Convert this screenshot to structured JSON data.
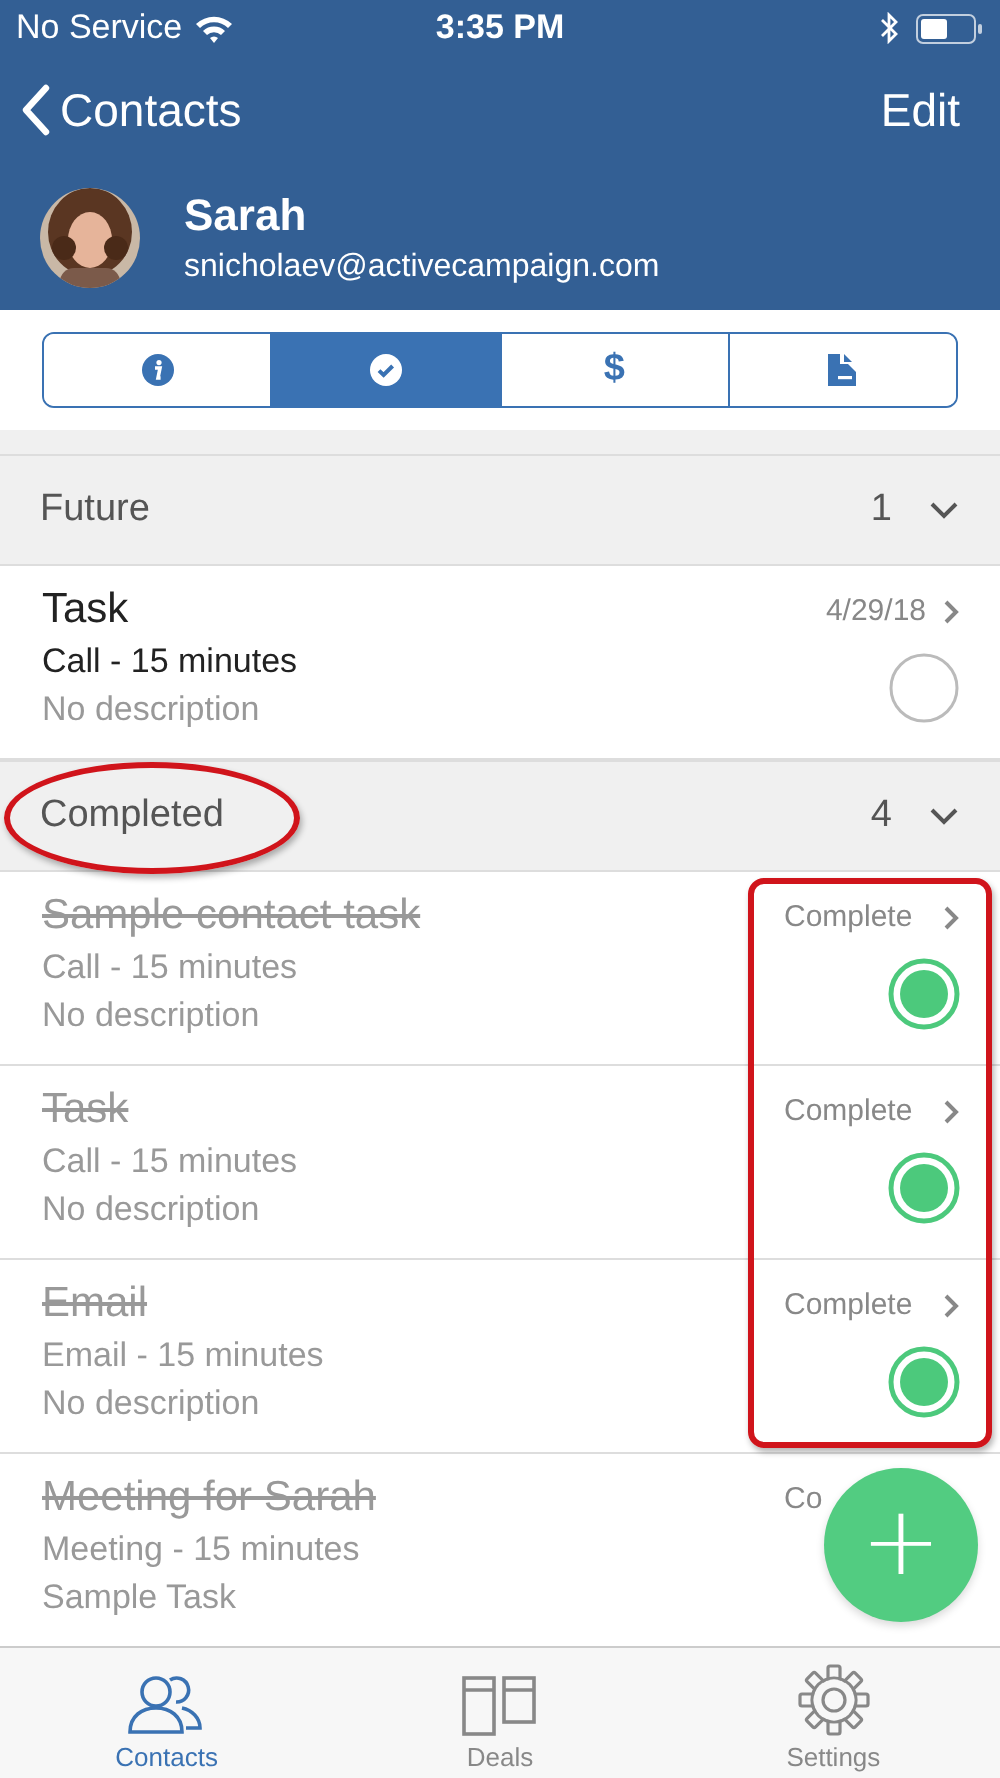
{
  "status_bar": {
    "carrier": "No Service",
    "time": "3:35 PM"
  },
  "nav": {
    "back": "Contacts",
    "action": "Edit"
  },
  "contact": {
    "name": "Sarah",
    "email": "snicholaev@activecampaign.com"
  },
  "segments": [
    {
      "kind": "info",
      "selected": false
    },
    {
      "kind": "tasks",
      "selected": true
    },
    {
      "kind": "deals",
      "glyph": "$",
      "selected": false
    },
    {
      "kind": "notes",
      "selected": false
    }
  ],
  "sections": [
    {
      "title": "Future",
      "count": "1",
      "expanded": true,
      "tasks": [
        {
          "title": "Task",
          "detail": "Call - 15 minutes",
          "description": "No description",
          "meta": "4/29/18",
          "done": false
        }
      ]
    },
    {
      "title": "Completed",
      "count": "4",
      "expanded": true,
      "annotated": true,
      "tasks": [
        {
          "title": "Sample contact task",
          "detail": "Call - 15 minutes",
          "description": "No description",
          "meta": "Complete",
          "done": true,
          "highlighted": true
        },
        {
          "title": "Task",
          "detail": "Call - 15 minutes",
          "description": "No description",
          "meta": "Complete",
          "done": true,
          "highlighted": true
        },
        {
          "title": "Email",
          "detail": "Email - 15 minutes",
          "description": "No description",
          "meta": "Complete",
          "done": true,
          "highlighted": true
        },
        {
          "title": "Meeting for Sarah",
          "detail": "Meeting - 15 minutes",
          "description": "Sample Task",
          "meta": "Co",
          "done": true,
          "highlighted": false
        }
      ]
    }
  ],
  "fab": {
    "label": "+"
  },
  "tab_bar": [
    {
      "label": "Contacts",
      "kind": "contacts",
      "selected": true
    },
    {
      "label": "Deals",
      "kind": "deals",
      "selected": false
    },
    {
      "label": "Settings",
      "kind": "settings",
      "selected": false
    }
  ]
}
